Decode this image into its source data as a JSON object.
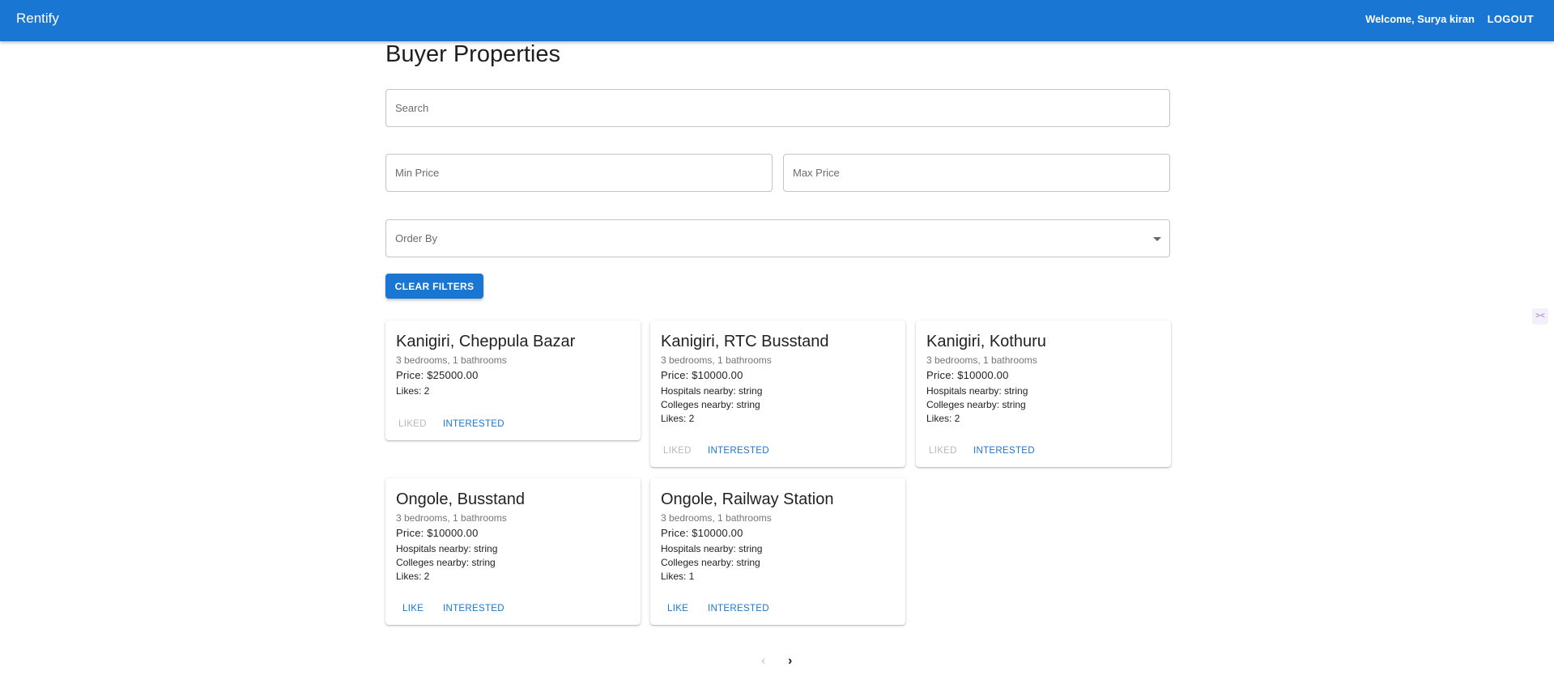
{
  "app": {
    "brand": "Rentify",
    "welcome": "Welcome, Surya kiran",
    "logout": "LOGOUT"
  },
  "page": {
    "title": "Buyer Properties"
  },
  "filters": {
    "search_placeholder": "Search",
    "min_price_placeholder": "Min Price",
    "max_price_placeholder": "Max Price",
    "order_by_placeholder": "Order By",
    "clear_label": "CLEAR FILTERS"
  },
  "properties": [
    {
      "title": "Kanigiri, Cheppula Bazar",
      "rooms": "3 bedrooms, 1 bathrooms",
      "price": "Price: $25000.00",
      "likes": "Likes: 2",
      "like_label": "LIKED",
      "interested_label": "INTERESTED"
    },
    {
      "title": "Kanigiri, RTC Busstand",
      "rooms": "3 bedrooms, 1 bathrooms",
      "price": "Price: $10000.00",
      "hospitals": "Hospitals nearby: string",
      "colleges": "Colleges nearby: string",
      "likes": "Likes: 2",
      "like_label": "LIKED",
      "interested_label": "INTERESTED"
    },
    {
      "title": "Kanigiri, Kothuru",
      "rooms": "3 bedrooms, 1 bathrooms",
      "price": "Price: $10000.00",
      "hospitals": "Hospitals nearby: string",
      "colleges": "Colleges nearby: string",
      "likes": "Likes: 2",
      "like_label": "LIKED",
      "interested_label": "INTERESTED"
    },
    {
      "title": "Ongole, Busstand",
      "rooms": "3 bedrooms, 1 bathrooms",
      "price": "Price: $10000.00",
      "hospitals": "Hospitals nearby: string",
      "colleges": "Colleges nearby: string",
      "likes": "Likes: 2",
      "like_label": "LIKE",
      "interested_label": "INTERESTED"
    },
    {
      "title": "Ongole, Railway Station",
      "rooms": "3 bedrooms, 1 bathrooms",
      "price": "Price: $10000.00",
      "hospitals": "Hospitals nearby: string",
      "colleges": "Colleges nearby: string",
      "likes": "Likes: 1",
      "like_label": "LIKE",
      "interested_label": "INTERESTED"
    }
  ],
  "pagination": {
    "prev_icon": "chevron-left-icon",
    "next_icon": "chevron-right-icon",
    "prev_glyph": "‹",
    "next_glyph": "›"
  },
  "colors": {
    "primary": "#1976d2",
    "disabled": "#b8b8b8"
  }
}
